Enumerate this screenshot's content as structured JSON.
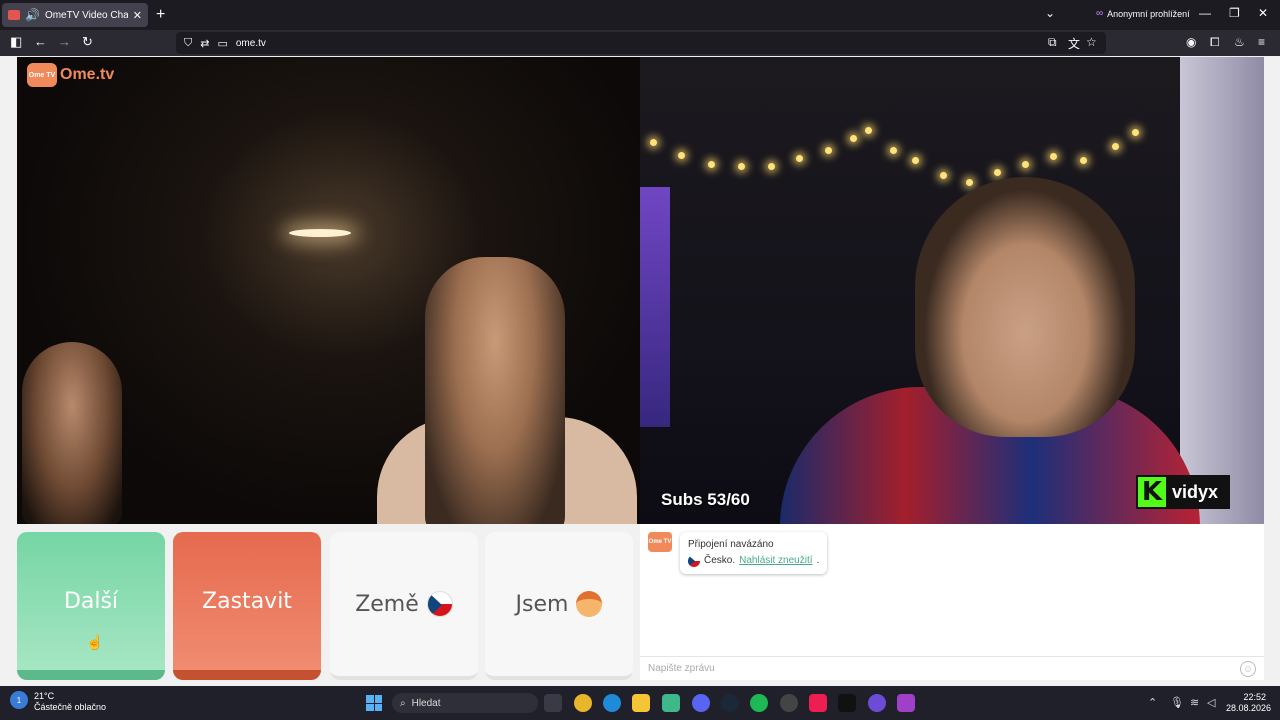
{
  "browser": {
    "tab_title": "OmeTV Video Chat — Ome",
    "new_tab_glyph": "+",
    "private_label": "Anonymní prohlížení",
    "url": "ome.tv"
  },
  "page": {
    "logo_badge": "Ome TV",
    "logo_text": "Ome.tv",
    "overlay_subs": "Subs 53/60",
    "overlay_brand": "vidyx",
    "overlay_brand_letter": "K",
    "buttons": {
      "next": "Další",
      "stop": "Zastavit",
      "country": "Země",
      "gender": "Jsem"
    },
    "chat": {
      "avatar_text": "Ome TV",
      "status": "Připojení navázáno",
      "country": "Česko.",
      "report_link": "Nahlásit zneužití",
      "report_suffix": ".",
      "input_placeholder": "Napište zprávu"
    }
  },
  "taskbar": {
    "temperature": "21°C",
    "weather": "Částečně oblačno",
    "weather_badge": "1",
    "search_placeholder": "Hledat",
    "time": "22:52",
    "date": "28.08.2026"
  }
}
